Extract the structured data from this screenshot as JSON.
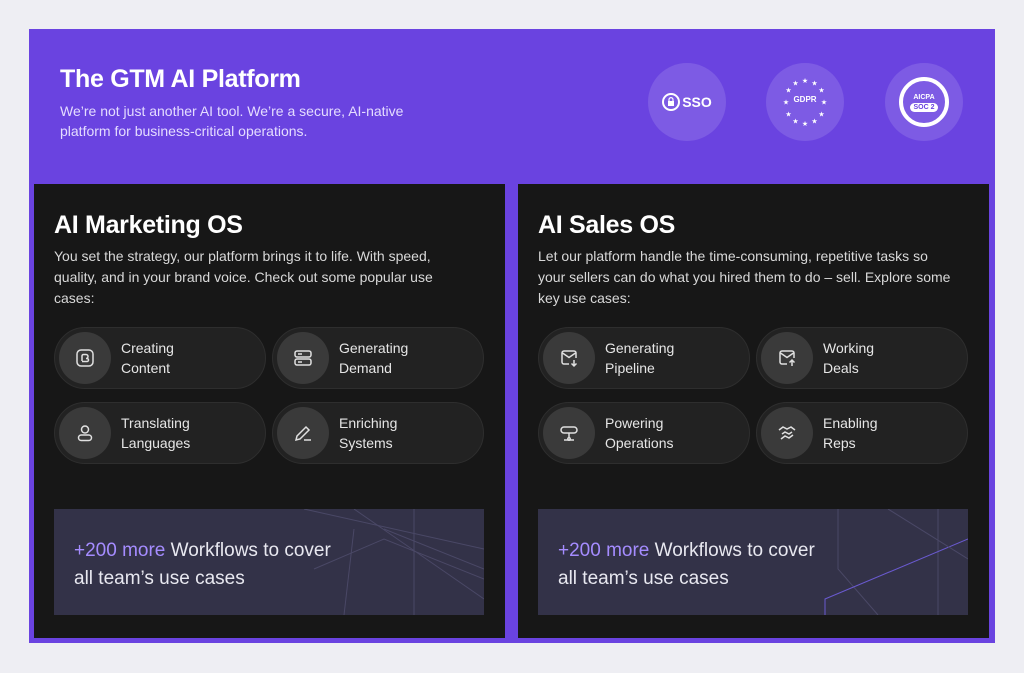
{
  "hero": {
    "title": "The GTM AI Platform",
    "subtitle": "We’re not just another AI tool. We’re a secure, AI-native platform for business-critical operations."
  },
  "badges": {
    "sso": "SSO",
    "gdpr": "GDPR",
    "soc_top": "AICPA",
    "soc_main": "SOC 2"
  },
  "marketing": {
    "title": "AI Marketing OS",
    "description": "You set the strategy, our platform brings it to life. With speed, quality, and in your brand voice. Check out some popular use cases:",
    "items": [
      {
        "line1": "Creating",
        "line2": "Content",
        "icon": "content-icon"
      },
      {
        "line1": "Generating",
        "line2": "Demand",
        "icon": "demand-icon"
      },
      {
        "line1": "Translating",
        "line2": "Languages",
        "icon": "person-icon"
      },
      {
        "line1": "Enriching",
        "line2": "Systems",
        "icon": "pencil-icon"
      }
    ],
    "banner_accent": "+200 more",
    "banner_rest": " Workflows to cover",
    "banner_line2": "all team’s use cases"
  },
  "sales": {
    "title": "AI Sales OS",
    "description": "Let our platform handle the time-consuming, repetitive tasks so your sellers can do what you hired them to do – sell. Explore some key use cases:",
    "items": [
      {
        "line1": "Generating",
        "line2": "Pipeline",
        "icon": "mail-in-icon"
      },
      {
        "line1": "Working",
        "line2": "Deals",
        "icon": "mail-up-icon"
      },
      {
        "line1": "Powering",
        "line2": "Operations",
        "icon": "network-icon"
      },
      {
        "line1": "Enabling",
        "line2": "Reps",
        "icon": "handshake-icon"
      }
    ],
    "banner_accent": "+200 more",
    "banner_rest": " Workflows to cover",
    "banner_line2": "all team’s use cases"
  },
  "colors": {
    "brand_purple": "#6a43e0",
    "panel_bg": "#171717",
    "accent": "#a58cff"
  }
}
